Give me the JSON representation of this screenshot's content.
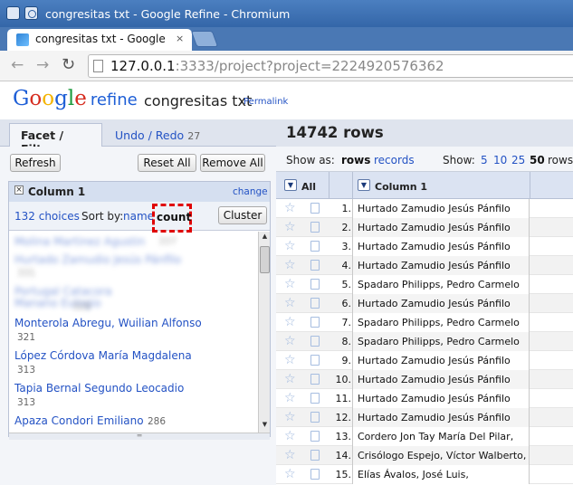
{
  "window": {
    "title": "congresitas txt - Google Refine - Chromium"
  },
  "browser": {
    "tab_title": "congresitas txt - Google",
    "tab_close": "×",
    "url_host": "127.0.0.1",
    "url_rest": ":3333/project?project=2224920576362",
    "nav": {
      "back": "←",
      "forward": "→",
      "reload": "↻"
    }
  },
  "app": {
    "logo": [
      "G",
      "o",
      "o",
      "g",
      "l",
      "e"
    ],
    "logo_suffix": "refine",
    "project_name": "congresitas txt",
    "permalink": "Permalink"
  },
  "left_panel": {
    "tabs": {
      "facet_filter": "Facet / Filter",
      "undo_redo": "Undo / Redo",
      "undo_count": "27"
    },
    "buttons": {
      "refresh": "Refresh",
      "reset_all": "Reset All",
      "remove_all": "Remove All"
    },
    "facet": {
      "close": "×",
      "column_name": "Column 1",
      "change": "change",
      "choices": "132 choices",
      "sort_by": "Sort by:",
      "sort_name": "name",
      "sort_count": "count",
      "cluster": "Cluster",
      "items": [
        {
          "label": "Molina Martinez Agustin",
          "count": "337",
          "blurred": true
        },
        {
          "label": "Hurtado Zamudio Jesús Pánfilo",
          "count": "331",
          "blurred": true
        },
        {
          "label": "Portugal Catacora Manano Eulogio",
          "count": "328",
          "blurred": true
        },
        {
          "label": "Monterola Abregu, Wuilian Alfonso",
          "count": "321",
          "blurred": false
        },
        {
          "label": "López Córdova María Magdalena",
          "count": "313",
          "blurred": false
        },
        {
          "label": "Tapia Bernal Segundo Leocadio",
          "count": "313",
          "blurred": false
        },
        {
          "label": "Apaza Condori Emiliano",
          "count": "286",
          "blurred": false
        }
      ]
    }
  },
  "right_panel": {
    "rows_count": "14742 rows",
    "show_as_label": "Show as:",
    "show_rows": "rows",
    "show_records": "records",
    "show_label": "Show:",
    "page_sizes": [
      "5",
      "10",
      "25",
      "50"
    ],
    "page_sizes_selected": "50",
    "page_sizes_suffix": "rows",
    "col_all": "All",
    "col_1": "Column 1",
    "dropdown_glyph": "▼",
    "rows": [
      {
        "n": "1.",
        "v": "Hurtado Zamudio Jesús Pánfilo"
      },
      {
        "n": "2.",
        "v": "Hurtado Zamudio Jesús Pánfilo"
      },
      {
        "n": "3.",
        "v": "Hurtado Zamudio Jesús Pánfilo"
      },
      {
        "n": "4.",
        "v": "Hurtado Zamudio Jesús Pánfilo"
      },
      {
        "n": "5.",
        "v": "Spadaro Philipps, Pedro Carmelo"
      },
      {
        "n": "6.",
        "v": "Hurtado Zamudio Jesús Pánfilo"
      },
      {
        "n": "7.",
        "v": "Spadaro Philipps, Pedro Carmelo"
      },
      {
        "n": "8.",
        "v": "Spadaro Philipps, Pedro Carmelo"
      },
      {
        "n": "9.",
        "v": "Hurtado Zamudio Jesús Pánfilo"
      },
      {
        "n": "10.",
        "v": "Hurtado Zamudio Jesús Pánfilo"
      },
      {
        "n": "11.",
        "v": "Hurtado Zamudio Jesús Pánfilo"
      },
      {
        "n": "12.",
        "v": "Hurtado Zamudio Jesús Pánfilo"
      },
      {
        "n": "13.",
        "v": "Cordero Jon Tay María Del Pilar,"
      },
      {
        "n": "14.",
        "v": "Crisólogo Espejo, Víctor Walberto,"
      },
      {
        "n": "15.",
        "v": "Elías Ávalos, José Luis,"
      }
    ]
  }
}
